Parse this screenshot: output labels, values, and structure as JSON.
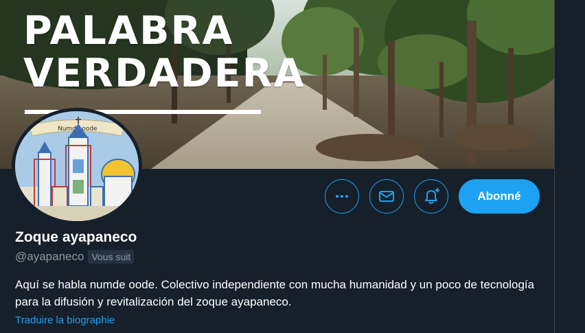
{
  "banner": {
    "title_line1": "PALABRA",
    "title_line2": "VERDADERA"
  },
  "avatar": {
    "ribbon_text": "Numde oode"
  },
  "actions": {
    "more_icon": "more-horizontal-icon",
    "message_icon": "envelope-icon",
    "notify_icon": "bell-plus-icon",
    "follow_label": "Abonné"
  },
  "profile": {
    "name": "Zoque ayapaneco",
    "handle": "@ayapaneco",
    "follows_you": "Vous suit",
    "bio": "Aquí se habla numde oode. Colectivo independiente con mucha humanidad y un poco de tecnología para la difusión y revitalización del zoque ayapaneco.",
    "translate_label": "Traduire la biographie"
  },
  "colors": {
    "background": "#15202b",
    "accent": "#1da1f2",
    "muted_text": "#8899a6",
    "primary_text": "#ffffff"
  }
}
